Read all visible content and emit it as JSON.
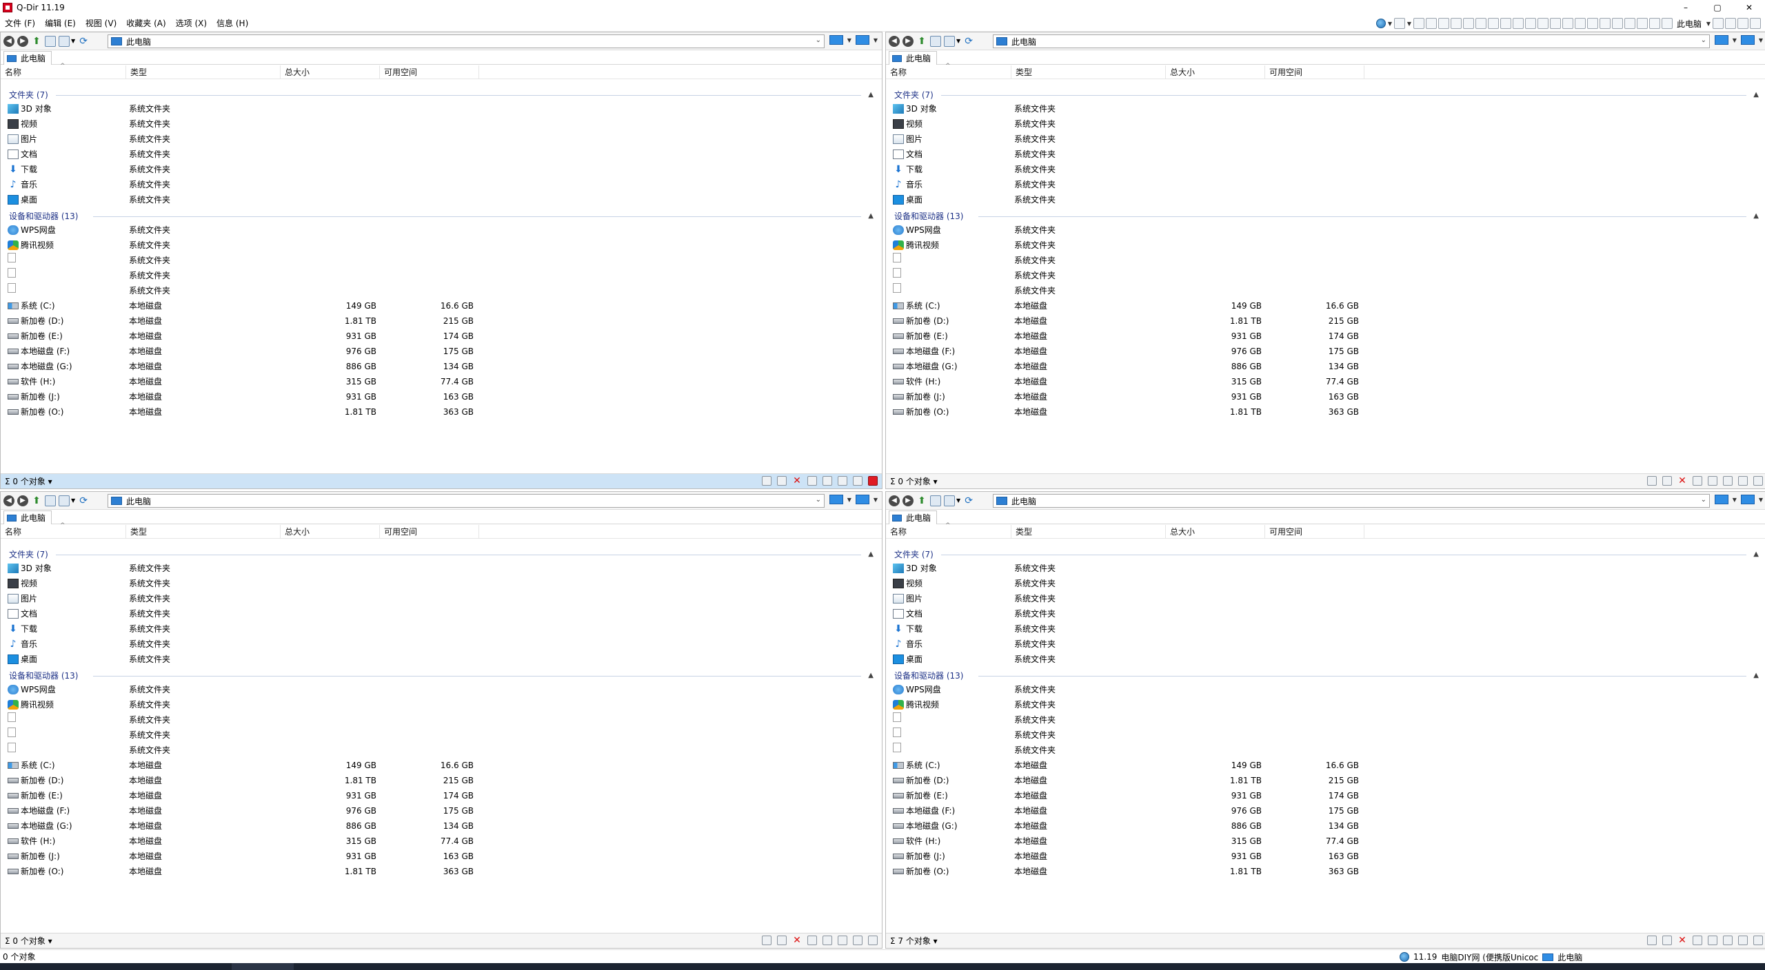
{
  "window": {
    "title": "Q-Dir 11.19",
    "controls": [
      "–",
      "▢",
      "✕"
    ]
  },
  "menu": [
    "文件 (F)",
    "编辑 (E)",
    "视图 (V)",
    "收藏夹 (A)",
    "选项 (X)",
    "信息 (H)"
  ],
  "toolbar_right": {
    "label": "此电脑"
  },
  "address": "此电脑",
  "tab_label": "此电脑",
  "columns": {
    "name": "名称",
    "type": "类型",
    "total": "总大小",
    "free": "可用空间"
  },
  "groups": {
    "folders": "文件夹 (7)",
    "devices": "设备和驱动器 (13)"
  },
  "folders": [
    {
      "name": "3D 对象",
      "type": "系统文件夹",
      "icon": "3d-objects-icon"
    },
    {
      "name": "视频",
      "type": "系统文件夹",
      "icon": "video-icon"
    },
    {
      "name": "图片",
      "type": "系统文件夹",
      "icon": "pictures-icon"
    },
    {
      "name": "文档",
      "type": "系统文件夹",
      "icon": "documents-icon"
    },
    {
      "name": "下载",
      "type": "系统文件夹",
      "icon": "download-icon"
    },
    {
      "name": "音乐",
      "type": "系统文件夹",
      "icon": "music-icon"
    },
    {
      "name": "桌面",
      "type": "系统文件夹",
      "icon": "desktop-icon"
    }
  ],
  "devices": [
    {
      "name": "WPS网盘",
      "type": "系统文件夹",
      "total": "",
      "free": "",
      "icon": "cloud-icon"
    },
    {
      "name": "腾讯视频",
      "type": "系统文件夹",
      "total": "",
      "free": "",
      "icon": "tencent-video-icon"
    },
    {
      "name": "",
      "type": "系统文件夹",
      "total": "",
      "free": "",
      "icon": "blank-file-icon"
    },
    {
      "name": "",
      "type": "系统文件夹",
      "total": "",
      "free": "",
      "icon": "blank-file-icon"
    },
    {
      "name": "",
      "type": "系统文件夹",
      "total": "",
      "free": "",
      "icon": "blank-file-icon"
    },
    {
      "name": "系统 (C:)",
      "type": "本地磁盘",
      "total": "149 GB",
      "free": "16.6 GB",
      "icon": "system-drive-icon"
    },
    {
      "name": "新加卷 (D:)",
      "type": "本地磁盘",
      "total": "1.81 TB",
      "free": "215 GB",
      "icon": "drive-icon"
    },
    {
      "name": "新加卷 (E:)",
      "type": "本地磁盘",
      "total": "931 GB",
      "free": "174 GB",
      "icon": "drive-icon"
    },
    {
      "name": "本地磁盘 (F:)",
      "type": "本地磁盘",
      "total": "976 GB",
      "free": "175 GB",
      "icon": "drive-icon"
    },
    {
      "name": "本地磁盘 (G:)",
      "type": "本地磁盘",
      "total": "886 GB",
      "free": "134 GB",
      "icon": "drive-icon"
    },
    {
      "name": "软件 (H:)",
      "type": "本地磁盘",
      "total": "315 GB",
      "free": "77.4 GB",
      "icon": "drive-icon"
    },
    {
      "name": "新加卷 (J:)",
      "type": "本地磁盘",
      "total": "931 GB",
      "free": "163 GB",
      "icon": "drive-icon"
    },
    {
      "name": "新加卷 (O:)",
      "type": "本地磁盘",
      "total": "1.81 TB",
      "free": "363 GB",
      "icon": "drive-icon"
    }
  ],
  "panes": [
    {
      "status": "0 个对象",
      "active": true
    },
    {
      "status": "0 个对象",
      "active": false
    },
    {
      "status": "0 个对象",
      "active": false
    },
    {
      "status": "7 个对象",
      "active": false
    }
  ],
  "app_status": {
    "left": "0 个对象",
    "version": "11.19",
    "site": "电脑DIY网 (便携版Unicoc",
    "location": "此电脑"
  },
  "colors": {
    "accent": "#cde3f6",
    "group_text": "#1e3287",
    "close_red": "#e01b24"
  }
}
